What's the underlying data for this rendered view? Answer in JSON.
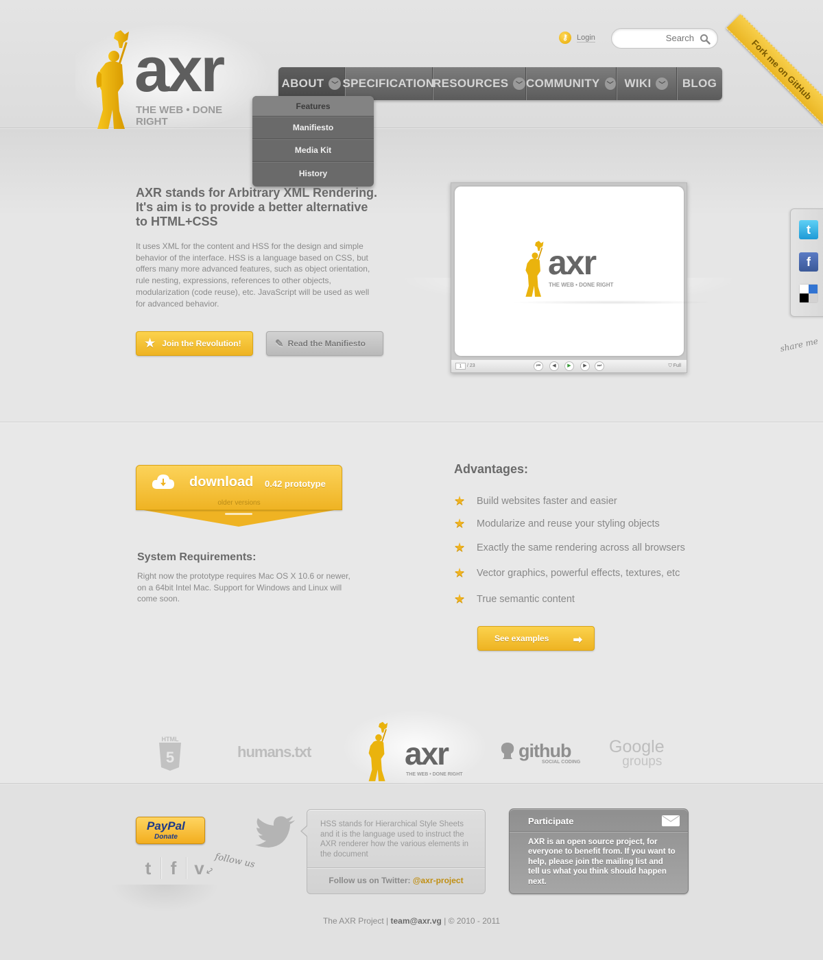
{
  "header": {
    "logo_text": "axr",
    "logo_tagline": "THE WEB  •  DONE RIGHT",
    "login_label": "Login",
    "search_placeholder": "Search",
    "ribbon_label": "Fork me on GitHub"
  },
  "nav": {
    "items": [
      {
        "label": "ABOUT",
        "has_menu": true,
        "active": true
      },
      {
        "label": "SPECIFICATION",
        "has_menu": false
      },
      {
        "label": "RESOURCES",
        "has_menu": true
      },
      {
        "label": "COMMUNITY",
        "has_menu": true
      },
      {
        "label": "WIKI",
        "has_menu": true
      },
      {
        "label": "BLOG",
        "has_menu": false
      }
    ],
    "dropdown": [
      "Features",
      "Manifiesto",
      "Media Kit",
      "History"
    ]
  },
  "hero": {
    "title": "AXR stands for Arbitrary XML Rendering. It's aim is to provide a better alternative to HTML+CSS",
    "body": "It uses XML for the content and HSS for the design and simple behavior of the interface. HSS  is a language based on CSS, but offers many more advanced features, such as object orientation, rule nesting, expressions, references to other objects, modularization (code reuse), etc. JavaScript will be used as well for advanced behavior.",
    "join_button": "Join the Revolution!",
    "manifesto_button": "Read the Manifiesto",
    "slideshow": {
      "page": "1",
      "total": "/ 23",
      "full_label": "Full",
      "logo_text": "axr",
      "logo_tagline": "THE WEB  •  DONE RIGHT"
    }
  },
  "share": {
    "note": "share me",
    "icons": [
      "twitter-icon",
      "facebook-icon",
      "delicious-icon"
    ]
  },
  "download": {
    "label": "download",
    "version": "0.42 prototype",
    "older": "older versions"
  },
  "requirements": {
    "title": "System Requirements:",
    "body": "Right now the prototype requires Mac OS X 10.6 or newer, on a 64bit Intel Mac. Support for Windows and Linux will come soon."
  },
  "advantages": {
    "title": "Advantages:",
    "items": [
      "Build websites faster and easier",
      "Modularize and reuse your styling objects",
      "Exactly the same rendering across all browsers",
      "Vector graphics, powerful effects, textures, etc",
      "True semantic content"
    ],
    "button": "See examples"
  },
  "partners": {
    "html5": "HTML",
    "humans": "humans.txt",
    "axr_text": "axr",
    "axr_tagline": "THE WEB  •  DONE RIGHT",
    "github": "github",
    "github_sub": "SOCIAL CODING",
    "google": "Google",
    "google_sub": "groups"
  },
  "footer": {
    "paypal": "PayPal",
    "donate": "Donate",
    "follow_note": "follow us",
    "tweet_text": "HSS stands for Hierarchical Style Sheets and it is the language used to instruct the AXR renderer how the various elements in the document",
    "follow_label": "Follow us on Twitter:",
    "twitter_handle": "@axr-project",
    "participate_title": "Participate",
    "participate_text": "AXR is an open source project, for everyone to benefit from. If you want to help, please join the mailing list and tell us what you think should happen next.",
    "copyright_project": "The AXR Project",
    "copyright_email": "team@axr.vg",
    "copyright_years": "© 2010 - 2011"
  },
  "colors": {
    "accent": "#efb323",
    "nav": "#6a6a6a",
    "background": "#e6e6e6"
  }
}
